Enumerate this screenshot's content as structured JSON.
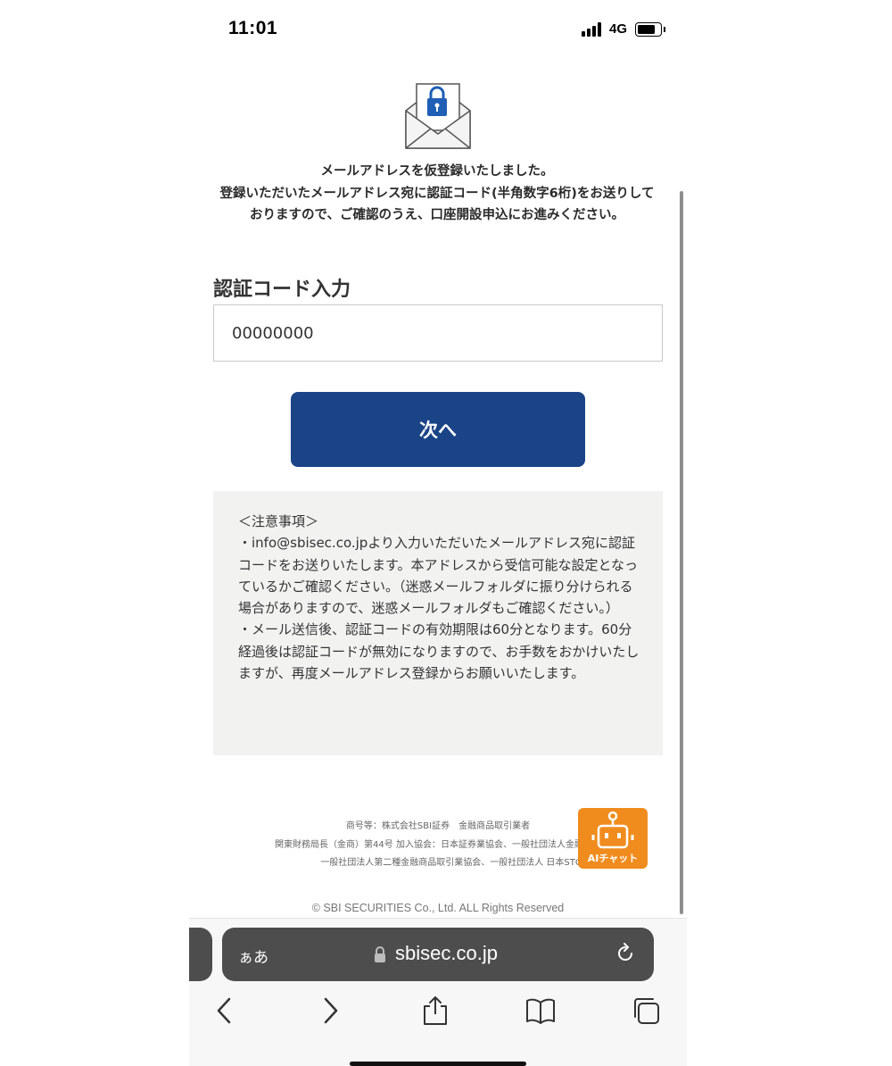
{
  "status_bar": {
    "time": "11:01",
    "network": "4G"
  },
  "page": {
    "intro_line1": "メールアドレスを仮登録いたしました。",
    "intro_line2": "登録いただいたメールアドレス宛に認証コード(半角数字6桁)をお送りしておりますので、ご確認のうえ、口座開設申込にお進みください。",
    "code_label": "認証コード入力",
    "code_value": "00000000",
    "next_button": "次へ",
    "notice": {
      "title": "＜注意事項＞",
      "item1": "・info@sbisec.co.jpより入力いただいたメールアドレス宛に認証コードをお送りいたします。本アドレスから受信可能な設定となっているかご確認ください。（迷惑メールフォルダに振り分けられる場合がありますので、迷惑メールフォルダもご確認ください。）",
      "item2": "・メール送信後、認証コードの有効期限は60分となります。60分経過後は認証コードが無効になりますので、お手数をおかけいたしますが、再度メールアドレス登録からお願いいたします。"
    },
    "footer": {
      "line1": "商号等：株式会社SBI証券　金融商品取引業者",
      "line2": "関東財務局長（金商）第44号 加入協会：日本証券業協会、一般社団法人金融先物",
      "line3": "一般社団法人第二種金融商品取引業協会、一般社団法人 日本STO協",
      "copyright": "© SBI SECURITIES Co., Ltd. ALL Rights Reserved"
    },
    "chat_button": "AIチャット"
  },
  "browser": {
    "text_size_label": "ぁあ",
    "url": "sbisec.co.jp"
  },
  "colors": {
    "primary_button": "#1a4486",
    "chat_button": "#f08c1e",
    "notice_background": "#f2f2f1",
    "lock_blue": "#1f5fb5"
  }
}
